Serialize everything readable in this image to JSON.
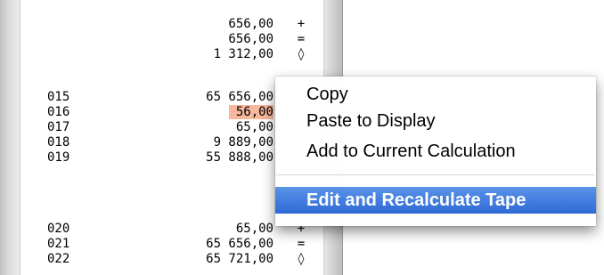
{
  "tape": {
    "lines": [
      {
        "num": "",
        "amount": "656,00",
        "op": "+"
      },
      {
        "num": "",
        "amount": "656,00",
        "op": "="
      },
      {
        "num": "",
        "amount": "1 312,00",
        "op": "◊"
      },
      {
        "num": "015",
        "amount": "65 656,00",
        "op": ""
      },
      {
        "num": "016",
        "amount": "56,00",
        "op": "",
        "highlighted": true
      },
      {
        "num": "017",
        "amount": "65,00",
        "op": ""
      },
      {
        "num": "018",
        "amount": "9 889,00",
        "op": ""
      },
      {
        "num": "019",
        "amount": "55 888,00",
        "op": ""
      },
      {
        "num": "020",
        "amount": "65,00",
        "op": "+"
      },
      {
        "num": "021",
        "amount": "65 656,00",
        "op": "="
      },
      {
        "num": "022",
        "amount": "65 721,00",
        "op": "◊"
      }
    ]
  },
  "context_menu": {
    "items": [
      {
        "label": "Copy"
      },
      {
        "label": "Paste to Display"
      },
      {
        "label": "Add to Current Calculation"
      },
      {
        "label": "Edit and Recalculate Tape",
        "selected": true
      }
    ]
  }
}
